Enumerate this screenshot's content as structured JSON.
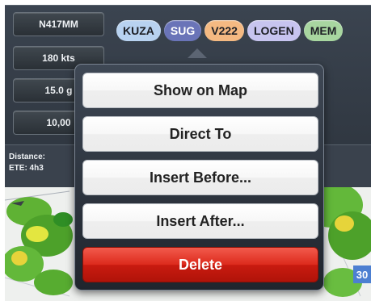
{
  "sidebar": {
    "tail_number": "N417MM",
    "speed": "180 kts",
    "fuel": "15.0 g",
    "altitude": "10,00"
  },
  "route": {
    "waypoints": [
      {
        "label": "KUZA",
        "kind": "airport"
      },
      {
        "label": "SUG",
        "kind": "selected"
      },
      {
        "label": "V222",
        "kind": "airway"
      },
      {
        "label": "LOGEN",
        "kind": "fix"
      },
      {
        "label": "MEM",
        "kind": "vor"
      }
    ]
  },
  "info": {
    "distance_label": "Distance:",
    "ete_label": "ETE: 4h3"
  },
  "map": {
    "badge": "30"
  },
  "popover": {
    "items": [
      {
        "label": "Show on Map",
        "style": "normal"
      },
      {
        "label": "Direct To",
        "style": "normal"
      },
      {
        "label": "Insert Before...",
        "style": "normal"
      },
      {
        "label": "Insert After...",
        "style": "normal"
      },
      {
        "label": "Delete",
        "style": "destructive"
      }
    ]
  },
  "colors": {
    "chip_airport": "#b8d2f0",
    "chip_selected": "#6a74b8",
    "chip_airway": "#f4b982",
    "chip_fix": "#c7c4ef",
    "chip_vor": "#a8d6a0",
    "delete_red": "#dd2a1c"
  }
}
